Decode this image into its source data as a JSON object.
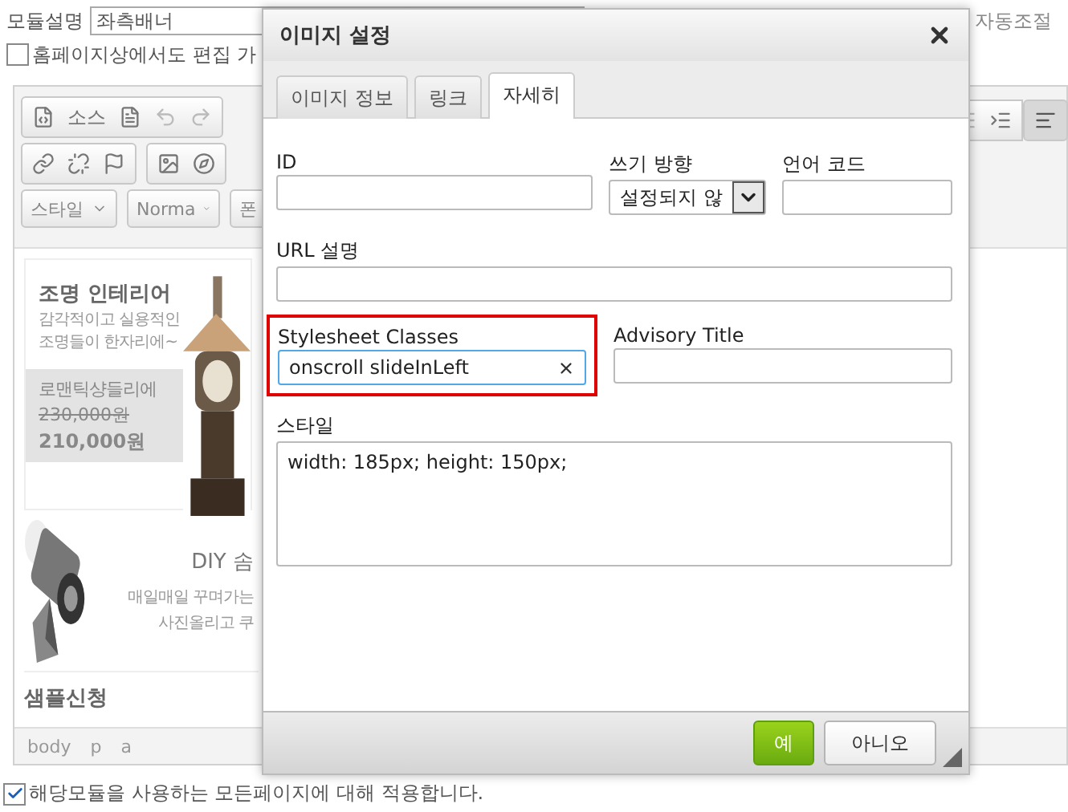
{
  "module": {
    "label": "모듈설명",
    "value": "좌측배너",
    "auto_label": "자동조절"
  },
  "edit_on_page": {
    "label": "홈페이지상에서도 편집 가",
    "checked": false
  },
  "editor": {
    "source_label": "소스",
    "style_combo": "스타일",
    "format_combo": "Norma",
    "font_combo": "폰",
    "banner": {
      "title": "조명 인테리어",
      "desc": [
        "감각적이고 실용적인",
        "조명들이 한자리에~"
      ],
      "product": "로맨틱샹들리에",
      "old_price": "230,000원",
      "price": "210,000원",
      "title_2": "DIY 솜",
      "desc_2": [
        "매일매일 꾸며가는",
        "사진올리고 쿠"
      ],
      "title_3": "샘플신청"
    },
    "path": [
      "body",
      "p",
      "a"
    ]
  },
  "apply_all": {
    "label": "해당모듈을 사용하는 모든페이지에 대해 적용합니다.",
    "checked": true
  },
  "dialog": {
    "title": "이미지 설정",
    "tabs": [
      {
        "label": "이미지 정보",
        "selected": false
      },
      {
        "label": "링크",
        "selected": false
      },
      {
        "label": "자세히",
        "selected": true
      }
    ],
    "id_label": "ID",
    "direction": {
      "label": "쓰기 방향",
      "value": "설정되지 않"
    },
    "lang_label": "언어 코드",
    "url_label": "URL 설명",
    "classes": {
      "label": "Stylesheet Classes",
      "value": "onscroll slideInLeft",
      "highlighted": true
    },
    "advisory_label": "Advisory Title",
    "style": {
      "label": "스타일",
      "value": "width: 185px; height: 150px;"
    },
    "buttons": [
      {
        "label": "예",
        "kind": "primary"
      },
      {
        "label": "아니오",
        "kind": "secondary"
      }
    ]
  }
}
